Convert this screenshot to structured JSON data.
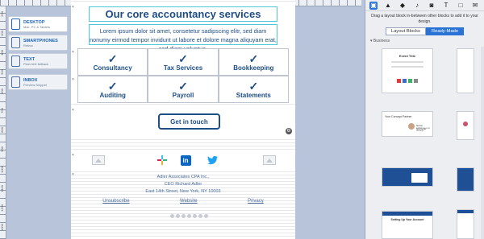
{
  "ruler": {
    "left_labels": [
      "200",
      "300",
      "400",
      "500",
      "600",
      "700",
      "800",
      "900",
      "1000",
      "1100",
      "1200",
      "1300"
    ]
  },
  "devices": [
    {
      "title": "DESKTOP",
      "subtitle": "Mac, PC & Tablets",
      "active": true
    },
    {
      "title": "SMARTPHONES",
      "subtitle": "Retina",
      "active": false
    },
    {
      "title": "TEXT",
      "subtitle": "Plain text fallback",
      "active": false
    },
    {
      "title": "INBOX",
      "subtitle": "Preview Snippet",
      "active": false
    }
  ],
  "email": {
    "title": "Our core accountancy services",
    "intro": "Lorem ipsum dolor sit amet, consetetur sadipscing elitr, sed diam nonumy eirmod tempor invidunt ut labore et dolore magna aliquyam erat, sed diam voluptua.",
    "services_row1": [
      "Consultancy",
      "Tax Services",
      "Bookkeeping"
    ],
    "services_row2": [
      "Auditing",
      "Payroll",
      "Statements"
    ],
    "check_glyph": "✓",
    "cta": "Get in touch",
    "social": {
      "linkedin": "in"
    },
    "address": [
      "Adler Associates CPA Inc.,",
      "CEO Richard Adler",
      "East 14th Street, New York, NY 10003"
    ],
    "footer_links": [
      "Unsubscribe",
      "Website",
      "Privacy"
    ],
    "remove_glyph": "×"
  },
  "panel": {
    "hint": "Drag a layout block in-between other blocks to add it to your design.",
    "tabs": [
      "Layout Blocks",
      "Ready-Made"
    ],
    "active_tab": "Ready-Made",
    "category": "▾ Business",
    "thumbs": {
      "event": {
        "title": "Event Title"
      },
      "partner": {
        "title": "Your Concept Partner",
        "name": "Name Surname",
        "role": "Global General Manager"
      },
      "account": {
        "title": "Setting Up Your Account"
      }
    }
  },
  "colors": {
    "brand": "#1e4e86",
    "accent": "#2a73d6",
    "guide": "#4cc9d6"
  }
}
